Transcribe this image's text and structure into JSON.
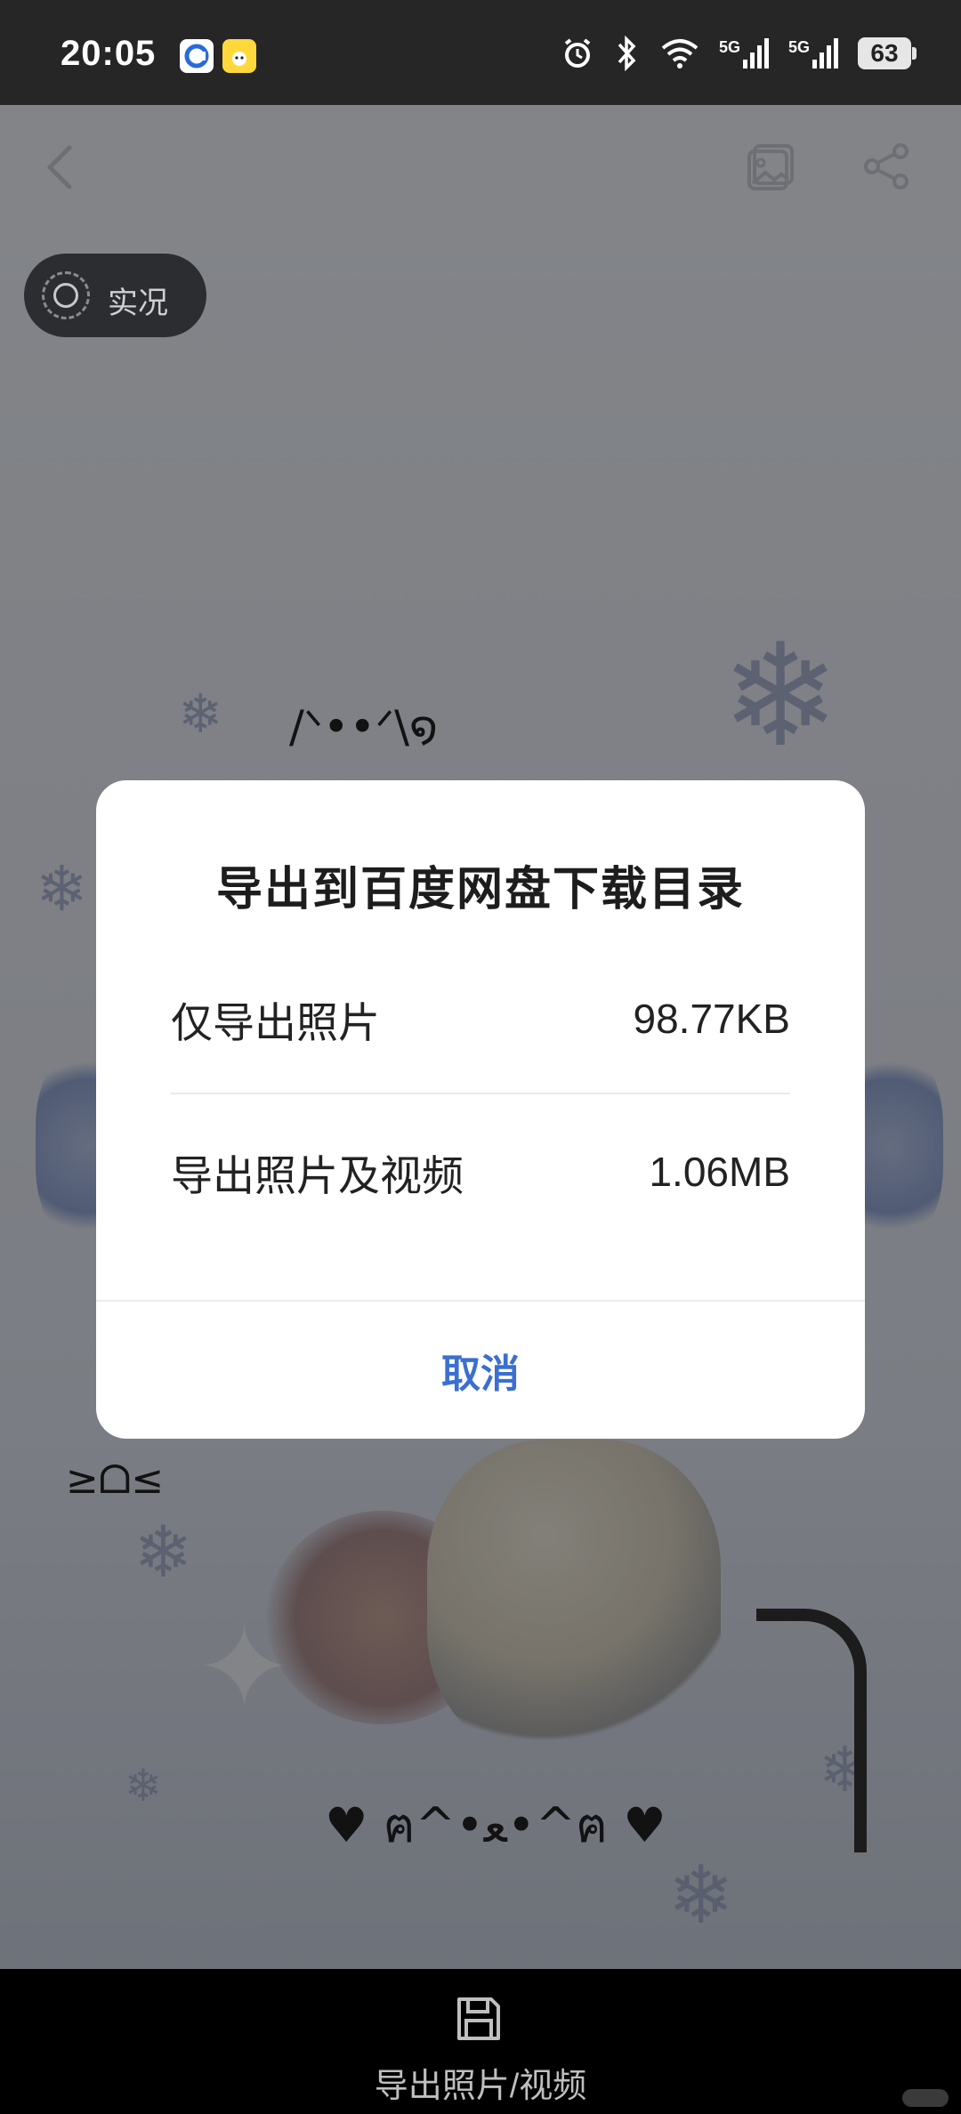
{
  "status_bar": {
    "time": "20:05",
    "battery": "63",
    "net1": "5G",
    "net2": "5G",
    "icons": [
      "alarm-icon",
      "bluetooth-icon",
      "wifi-icon",
      "signal-icon",
      "signal-icon",
      "battery-icon"
    ]
  },
  "toolbar": {
    "back_icon": "chevron-left-icon",
    "image_icon": "photo-icon",
    "share_icon": "share-icon"
  },
  "live_badge": {
    "label": "实况"
  },
  "photo": {
    "kaomoji_top": "/ᐠ••ᐟ\\໑",
    "kaomoji_cat": "≥ᗝ≤",
    "kaomoji_bottom": "♥ ฅ^•ﻌ•^ฅ ♥"
  },
  "dialog": {
    "title": "导出到百度网盘下载目录",
    "options": [
      {
        "label": "仅导出照片",
        "size": "98.77KB"
      },
      {
        "label": "导出照片及视频",
        "size": "1.06MB"
      }
    ],
    "cancel_label": "取消"
  },
  "bottom_bar": {
    "save_label": "导出照片/视频",
    "save_icon": "save-icon"
  },
  "colors": {
    "accent": "#3b6fd0",
    "dialog_bg": "#ffffff",
    "overlay": "rgba(0,0,0,0.45)"
  }
}
